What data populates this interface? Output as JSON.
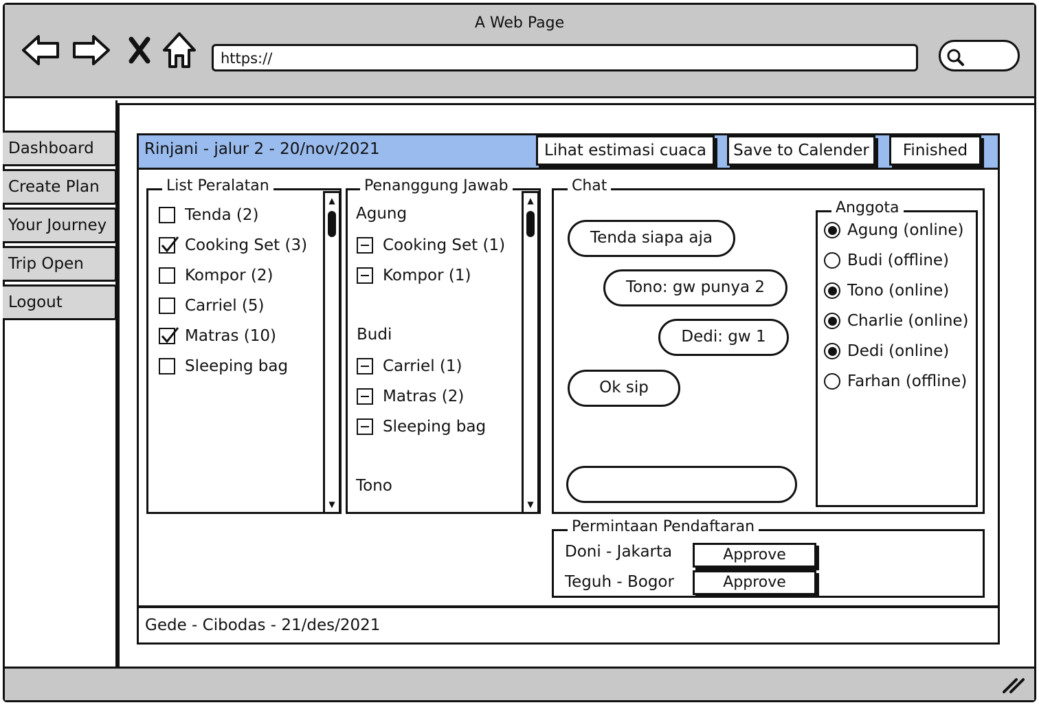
{
  "window": {
    "title": "A Web Page"
  },
  "browser": {
    "url": "https://",
    "back_icon": "arrow-left-icon",
    "forward_icon": "arrow-right-icon",
    "stop_icon": "close-icon",
    "home_icon": "home-icon",
    "search_icon": "search-icon"
  },
  "sidebar": {
    "items": [
      {
        "label": "Dashboard"
      },
      {
        "label": "Create Plan"
      },
      {
        "label": "Your Journey"
      },
      {
        "label": "Trip Open"
      },
      {
        "label": "Logout"
      }
    ]
  },
  "trip": {
    "title": "Rinjani - jalur 2 - 20/nov/2021",
    "header_color": "#99bbee",
    "buttons": {
      "weather": "Lihat estimasi cuaca",
      "calendar": "Save to Calender",
      "finished": "Finished"
    },
    "equipment": {
      "title": "List Peralatan",
      "items": [
        {
          "label": "Tenda (2)",
          "checked": false
        },
        {
          "label": "Cooking Set (3)",
          "checked": true
        },
        {
          "label": "Kompor (2)",
          "checked": false
        },
        {
          "label": "Carriel (5)",
          "checked": false
        },
        {
          "label": "Matras (10)",
          "checked": true
        },
        {
          "label": "Sleeping bag",
          "checked": false
        }
      ]
    },
    "responsible": {
      "title": "Penanggung Jawab",
      "groups": [
        {
          "name": "Agung",
          "items": [
            "Cooking Set (1)",
            "Kompor (1)"
          ]
        },
        {
          "name": "Budi",
          "items": [
            "Carriel (1)",
            "Matras (2)",
            "Sleeping bag"
          ]
        },
        {
          "name": "Tono",
          "items": []
        }
      ]
    },
    "chat": {
      "title": "Chat",
      "messages": [
        {
          "text": "Tenda siapa aja"
        },
        {
          "text": "Tono:  gw punya 2"
        },
        {
          "text": "Dedi:  gw 1"
        },
        {
          "text": "Ok sip"
        }
      ],
      "input_value": ""
    },
    "members": {
      "title": "Anggota",
      "items": [
        {
          "label": "Agung (online)",
          "online": true
        },
        {
          "label": "Budi (offline)",
          "online": false
        },
        {
          "label": "Tono (online)",
          "online": true
        },
        {
          "label": "Charlie (online)",
          "online": true
        },
        {
          "label": "Dedi (online)",
          "online": true
        },
        {
          "label": "Farhan (offline)",
          "online": false
        }
      ]
    },
    "requests": {
      "title": "Permintaan Pendaftaran",
      "items": [
        {
          "label": "Doni - Jakarta",
          "button": "Approve"
        },
        {
          "label": "Teguh - Bogor",
          "button": "Approve"
        }
      ]
    }
  },
  "other_trip": {
    "title": "Gede - Cibodas - 21/des/2021"
  }
}
